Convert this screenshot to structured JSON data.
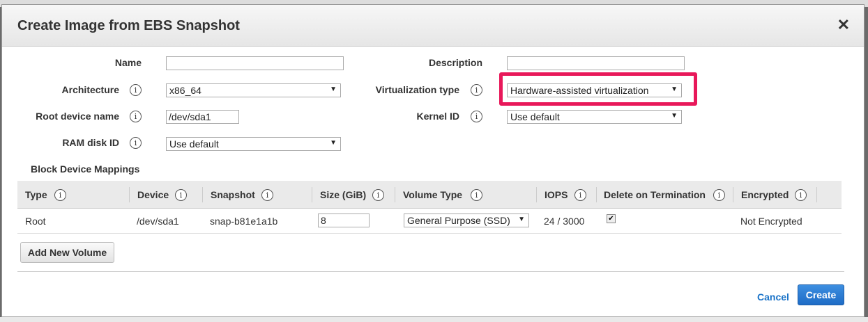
{
  "dialog": {
    "title": "Create Image from EBS Snapshot",
    "close_glyph": "✕"
  },
  "form": {
    "name_label": "Name",
    "name_value": "",
    "description_label": "Description",
    "description_value": "",
    "architecture_label": "Architecture",
    "architecture_value": "x86_64",
    "virtualization_label": "Virtualization type",
    "virtualization_value": "Hardware-assisted virtualization",
    "root_device_label": "Root device name",
    "root_device_value": "/dev/sda1",
    "kernel_label": "Kernel ID",
    "kernel_value": "Use default",
    "ramdisk_label": "RAM disk ID",
    "ramdisk_value": "Use default",
    "info_glyph": "i"
  },
  "block_device": {
    "section_label": "Block Device Mappings",
    "headers": [
      "Type",
      "Device",
      "Snapshot",
      "Size (GiB)",
      "Volume Type",
      "IOPS",
      "Delete on Termination",
      "Encrypted"
    ],
    "row": {
      "type": "Root",
      "device": "/dev/sda1",
      "snapshot": "snap-b81e1a1b",
      "size": "8",
      "volume_type": "General Purpose (SSD)",
      "iops": "24 / 3000",
      "delete_on_termination": true,
      "encrypted": "Not Encrypted"
    },
    "add_button": "Add New Volume"
  },
  "footer": {
    "cancel": "Cancel",
    "create": "Create"
  },
  "colors": {
    "highlight": "#e8185a",
    "primary": "#1e6cc6",
    "link": "#1a73c8"
  }
}
